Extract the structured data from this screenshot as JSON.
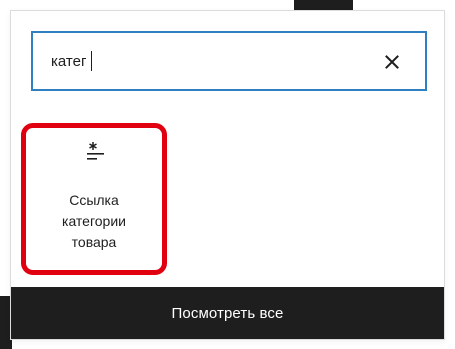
{
  "search": {
    "value": "катег",
    "clear_icon": "close-icon"
  },
  "results": [
    {
      "icon": "category-link-icon",
      "label": "Ссылка\nкатегории\nтовара",
      "highlight_color": "#e0000f"
    }
  ],
  "footer": {
    "label": "Посмотреть все"
  },
  "colors": {
    "accent": "#2f7fc1",
    "dark": "#1e1e1e",
    "highlight": "#e0000f"
  }
}
